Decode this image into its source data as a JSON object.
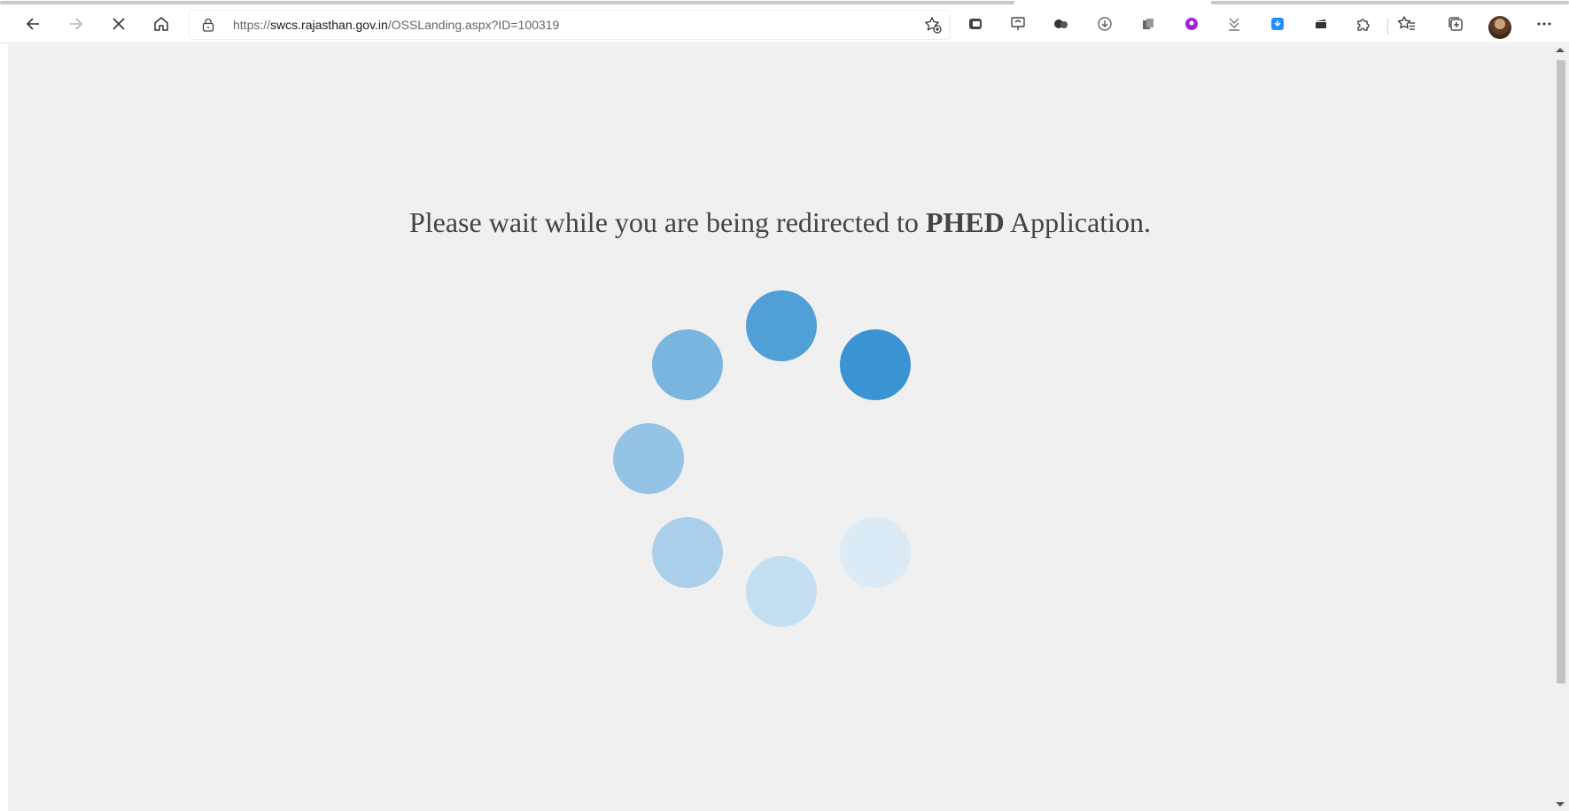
{
  "browser": {
    "url_scheme": "https://",
    "url_host": "swcs.rajasthan.gov.in",
    "url_path": "/OSSLanding.aspx?ID=100319",
    "nav_icons": [
      "back-icon",
      "forward-icon",
      "stop-loading-icon",
      "home-icon"
    ],
    "extension_icons": [
      "extension-1-icon",
      "extension-2-icon",
      "extension-3-icon",
      "download-circle-icon",
      "extension-5-icon",
      "purple-extension-icon",
      "download-arrow-icon",
      "blue-download-icon",
      "clapper-icon",
      "extensions-puzzle-icon",
      "favorites-icon",
      "collections-icon",
      "profile-avatar",
      "more-menu-icon"
    ],
    "state": "loading"
  },
  "page": {
    "message_prefix": "Please wait while you are being redirected to",
    "message_app": "PHED",
    "message_suffix": "Application.",
    "background": "#f0f0f0",
    "text_color": "#444444"
  },
  "spinner": {
    "dot_count": 8,
    "dots": [
      {
        "name": "spinner-dot-top",
        "color": "#519fd7"
      },
      {
        "name": "spinner-dot-top-right",
        "color": "#3a93d3"
      },
      {
        "name": "spinner-dot-right",
        "color": "#f0f0f0"
      },
      {
        "name": "spinner-dot-bottom-right",
        "color": "#dceaf5"
      },
      {
        "name": "spinner-dot-bottom",
        "color": "#c4dff1"
      },
      {
        "name": "spinner-dot-bottom-left",
        "color": "#aad0ec"
      },
      {
        "name": "spinner-dot-left",
        "color": "#94c3e6"
      },
      {
        "name": "spinner-dot-top-left",
        "color": "#7ab5e0"
      }
    ]
  }
}
